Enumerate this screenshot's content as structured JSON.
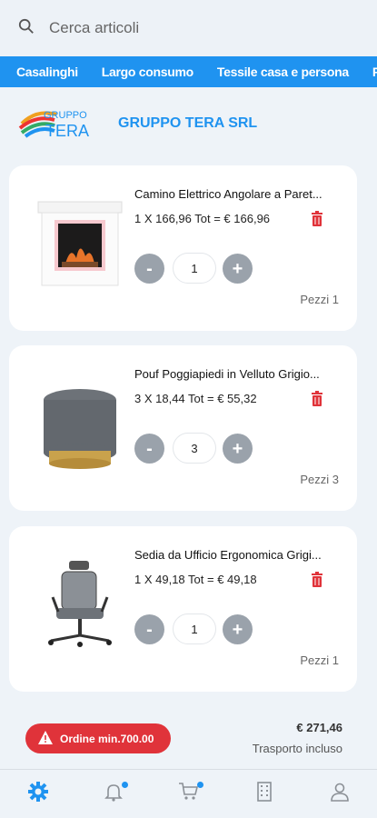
{
  "search": {
    "placeholder": "Cerca articoli"
  },
  "categories": [
    "Casalinghi",
    "Largo consumo",
    "Tessile casa e persona",
    "Pr"
  ],
  "company": {
    "logo_text_top": "GRUPPO",
    "logo_text_bottom": "TERA",
    "name": "GRUPPO TERA SRL"
  },
  "products": [
    {
      "title": "Camino Elettrico Angolare a Paret...",
      "price_line": "1 X 166,96 Tot = € 166,96",
      "quantity": "1",
      "pieces": "Pezzi 1",
      "image": "electric-fireplace"
    },
    {
      "title": "Pouf Poggiapiedi in Velluto Grigio...",
      "price_line": "3 X 18,44 Tot = € 55,32",
      "quantity": "3",
      "pieces": "Pezzi 3",
      "image": "grey-velvet-pouf"
    },
    {
      "title": "Sedia da Ufficio Ergonomica Grigi...",
      "price_line": "1 X 49,18 Tot = € 49,18",
      "quantity": "1",
      "pieces": "Pezzi 1",
      "image": "office-chair"
    }
  ],
  "buttons": {
    "minus": "-",
    "plus": "+"
  },
  "summary": {
    "min_order": "Ordine min.700.00",
    "total": "€ 271,46",
    "transport": "Trasporto incluso"
  },
  "nav": [
    "settings",
    "notifications",
    "cart",
    "company",
    "profile"
  ],
  "colors": {
    "accent": "#1f93f0",
    "danger": "#e0333a",
    "stepper": "#9aa2ab"
  }
}
